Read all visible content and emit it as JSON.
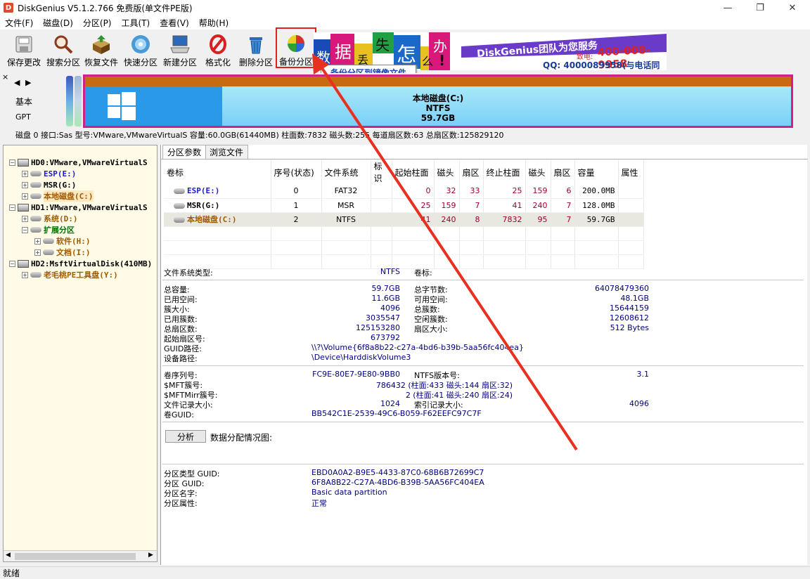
{
  "window": {
    "title": "DiskGenius V5.1.2.766 免费版(单文件PE版)",
    "minimize": "—",
    "maximize": "❐",
    "close": "✕"
  },
  "menu": [
    "文件(F)",
    "磁盘(D)",
    "分区(P)",
    "工具(T)",
    "查看(V)",
    "帮助(H)"
  ],
  "toolbar": {
    "buttons": [
      {
        "label": "保存更改",
        "icon": "save-icon"
      },
      {
        "label": "搜索分区",
        "icon": "magnifier-icon"
      },
      {
        "label": "恢复文件",
        "icon": "recover-box-icon"
      },
      {
        "label": "快速分区",
        "icon": "disk-cd-icon"
      },
      {
        "label": "新建分区",
        "icon": "computer-icon"
      },
      {
        "label": "格式化",
        "icon": "format-icon"
      },
      {
        "label": "删除分区",
        "icon": "trash-icon"
      },
      {
        "label": "备份分区",
        "icon": "pie-chart-icon"
      }
    ],
    "tooltip": "备份分区到镜像文件"
  },
  "banner": {
    "chars": [
      "数",
      "据",
      "丢",
      "失",
      "怎",
      "么",
      "办",
      "!"
    ],
    "line1": "DiskGenius团队为您服务",
    "phone": "400-008-9958",
    "phone_prefix": "致电:",
    "qq": "QQ: 4000089958(与电话同号)"
  },
  "diskmap": {
    "disk_type": "基本",
    "partition_style": "GPT",
    "partition_name": "本地磁盘(C:)",
    "fs": "NTFS",
    "size": "59.7GB",
    "info": "磁盘 0 接口:Sas  型号:VMware,VMwareVirtualS  容量:60.0GB(61440MB)  柱面数:7832  磁头数:255  每道扇区数:63  总扇区数:125829120"
  },
  "tree": [
    {
      "label": "HD0:VMware,VMwareVirtualS",
      "level": 0,
      "type": "disk",
      "color": "#000000"
    },
    {
      "label": "ESP(E:)",
      "level": 1,
      "type": "part",
      "color": "#1a1ad0"
    },
    {
      "label": "MSR(G:)",
      "level": 1,
      "type": "part",
      "color": "#000000"
    },
    {
      "label": "本地磁盘(C:)",
      "level": 1,
      "type": "part",
      "color": "#a05a00",
      "selected": true
    },
    {
      "label": "HD1:VMware,VMwareVirtualS",
      "level": 0,
      "type": "disk",
      "color": "#000000"
    },
    {
      "label": "系统(D:)",
      "level": 1,
      "type": "part",
      "color": "#a05a00"
    },
    {
      "label": "扩展分区",
      "level": 1,
      "type": "ext",
      "color": "#007000"
    },
    {
      "label": "软件(H:)",
      "level": 2,
      "type": "part",
      "color": "#a05a00"
    },
    {
      "label": "文档(I:)",
      "level": 2,
      "type": "part",
      "color": "#a05a00"
    },
    {
      "label": "HD2:MsftVirtualDisk(410MB)",
      "level": 0,
      "type": "disk",
      "color": "#000000"
    },
    {
      "label": "老毛桃PE工具盘(Y:)",
      "level": 1,
      "type": "part",
      "color": "#a05a00"
    }
  ],
  "tabs": [
    "分区参数",
    "浏览文件"
  ],
  "table": {
    "headers": [
      "卷标",
      "序号(状态)",
      "文件系统",
      "标识",
      "起始柱面",
      "磁头",
      "扇区",
      "终止柱面",
      "磁头",
      "扇区",
      "容量",
      "属性"
    ],
    "rows": [
      {
        "label": "ESP(E:)",
        "index": "0",
        "fs": "FAT32",
        "id": "",
        "start_cyl": "0",
        "start_head": "32",
        "start_sec": "33",
        "end_cyl": "25",
        "end_head": "159",
        "end_sec": "6",
        "size": "200.0MB",
        "attr": ""
      },
      {
        "label": "MSR(G:)",
        "index": "1",
        "fs": "MSR",
        "id": "",
        "start_cyl": "25",
        "start_head": "159",
        "start_sec": "7",
        "end_cyl": "41",
        "end_head": "240",
        "end_sec": "7",
        "size": "128.0MB",
        "attr": ""
      },
      {
        "label": "本地磁盘(C:)",
        "index": "2",
        "fs": "NTFS",
        "id": "",
        "start_cyl": "41",
        "start_head": "240",
        "start_sec": "8",
        "end_cyl": "7832",
        "end_head": "95",
        "end_sec": "7",
        "size": "59.7GB",
        "attr": ""
      }
    ]
  },
  "info": {
    "fs_type_label": "文件系统类型:",
    "fs_type": "NTFS",
    "vol_label": "卷标:",
    "total_cap_label": "总容量:",
    "total_cap": "59.7GB",
    "total_bytes_label": "总字节数:",
    "total_bytes": "64078479360",
    "used_label": "已用空间:",
    "used": "11.6GB",
    "free_label": "可用空间:",
    "free": "48.1GB",
    "cluster_label": "簇大小:",
    "cluster": "4096",
    "total_clusters_label": "总簇数:",
    "total_clusters": "15644159",
    "used_clusters_label": "已用簇数:",
    "used_clusters": "3035547",
    "free_clusters_label": "空闲簇数:",
    "free_clusters": "12608612",
    "total_sectors_label": "总扇区数:",
    "total_sectors": "125153280",
    "sector_size_label": "扇区大小:",
    "sector_size": "512 Bytes",
    "start_sector_label": "起始扇区号:",
    "start_sector": "673792",
    "guid_path_label": "GUID路径:",
    "guid_path": "\\\\?\\Volume{6f8a8b22-c27a-4bd6-b39b-5aa56fc404ea}",
    "device_path_label": "设备路径:",
    "device_path": "\\Device\\HarddiskVolume3",
    "serial_label": "卷序列号:",
    "serial": "FC9E-80E7-9E80-9BB0",
    "ntfs_ver_label": "NTFS版本号:",
    "ntfs_ver": "3.1",
    "mft_label": "$MFT簇号:",
    "mft": "786432 (柱面:433 磁头:144 扇区:32)",
    "mftmirr_label": "$MFTMirr簇号:",
    "mftmirr": "2 (柱面:41 磁头:240 扇区:24)",
    "file_rec_label": "文件记录大小:",
    "file_rec": "1024",
    "index_rec_label": "索引记录大小:",
    "index_rec": "4096",
    "vol_guid_label": "卷GUID:",
    "vol_guid": "BB542C1E-2539-49C6-B059-F62EEFC97C7F",
    "analyze_btn": "分析",
    "alloc_label": "数据分配情况图:",
    "ptype_guid_label": "分区类型 GUID:",
    "ptype_guid": "EBD0A0A2-B9E5-4433-87C0-68B6B72699C7",
    "part_guid_label": "分区 GUID:",
    "part_guid": "6F8A8B22-C27A-4BD6-B39B-5AA56FC404EA",
    "part_name_label": "分区名字:",
    "part_name": "Basic data partition",
    "part_attr_label": "分区属性:",
    "part_attr": "正常"
  },
  "status": "就绪"
}
